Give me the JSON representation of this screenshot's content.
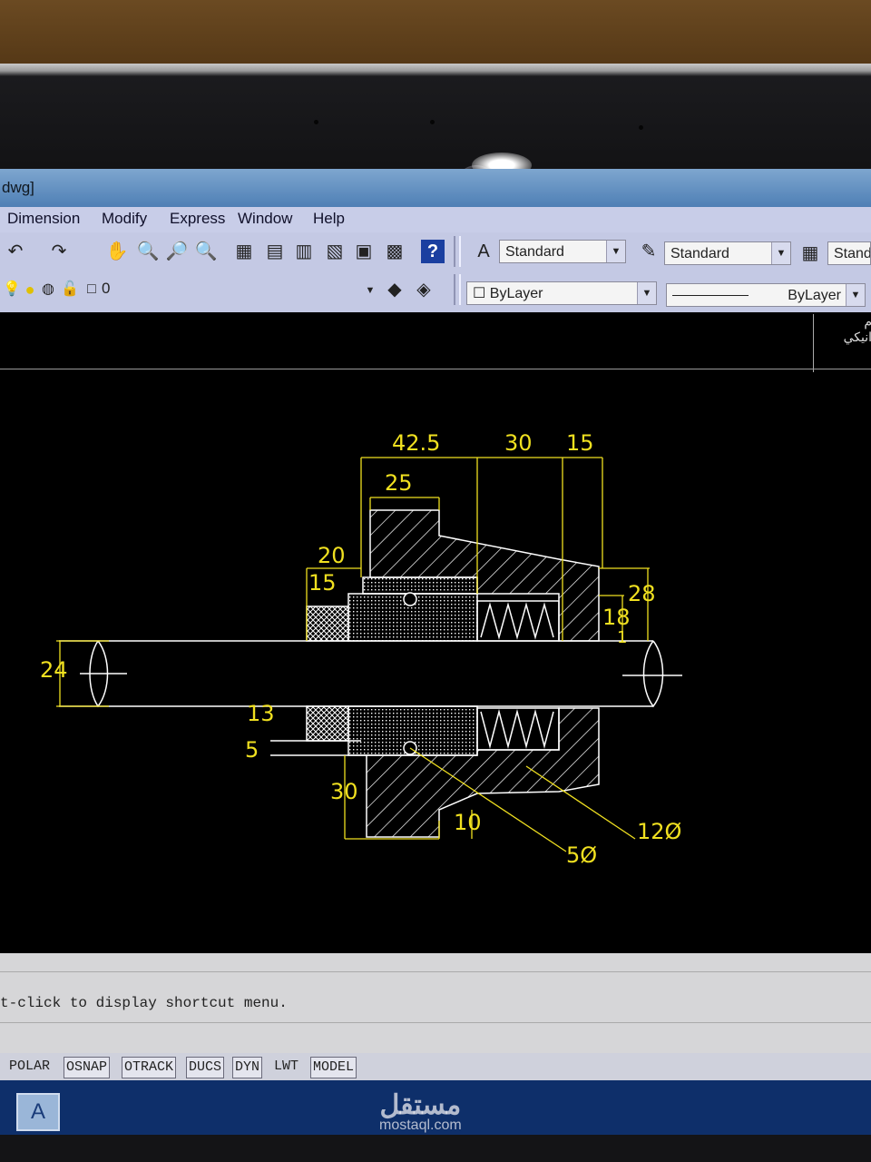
{
  "window": {
    "title_fragment": "dwg]"
  },
  "menu": [
    "Dimension",
    "Modify",
    "Express",
    "Window",
    "Help"
  ],
  "toolbar": {
    "text_style": "Standard",
    "dim_style": "Standard",
    "table_style": "Standa",
    "layer": "0",
    "color": "ByLayer",
    "linetype": "ByLayer"
  },
  "right_panel": {
    "line1": "م",
    "line2": "انيكي"
  },
  "drawing": {
    "dimensions": [
      "42.5",
      "30",
      "15",
      "25",
      "20",
      "15",
      "28",
      "18",
      "1",
      "24",
      "13",
      "5",
      "30",
      "10",
      "5Ø",
      "12Ø"
    ]
  },
  "command": {
    "text": "t-click to display shortcut menu."
  },
  "status": [
    "POLAR",
    "OSNAP",
    "OTRACK",
    "DUCS",
    "DYN",
    "LWT",
    "MODEL"
  ],
  "watermark": {
    "arabic": "مستقل",
    "latin": "mostaql.com"
  },
  "colors": {
    "dimension": "#f0e020",
    "geometry": "#ffffff",
    "background": "#000000"
  }
}
